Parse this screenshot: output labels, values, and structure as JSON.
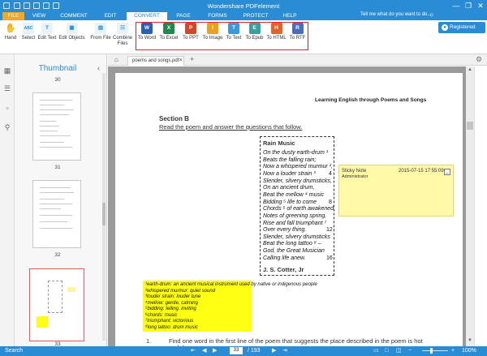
{
  "window": {
    "title": "Wondershare PDFelement",
    "controls": [
      "—",
      "❐",
      "✕"
    ]
  },
  "menu": {
    "tabs": [
      "FILE",
      "VIEW",
      "COMMENT",
      "EDIT",
      "CONVERT",
      "PAGE",
      "FORMS",
      "PROTECT",
      "HELP"
    ],
    "active": "CONVERT",
    "tell_me": "Tell me what do you want to do..."
  },
  "ribbon": {
    "tools": [
      {
        "label": "Hand",
        "icon": "hand-icon"
      },
      {
        "label": "Select",
        "icon": "select-icon"
      },
      {
        "label": "Edit Text",
        "icon": "edit-text-icon"
      },
      {
        "label": "Edit Objects",
        "icon": "edit-objects-icon"
      },
      {
        "label": "From File",
        "icon": "folder-icon"
      },
      {
        "label": "Combine Files",
        "icon": "combine-icon"
      }
    ],
    "convert": [
      {
        "label": "To Word",
        "letter": "W",
        "color": "#2b5fb4"
      },
      {
        "label": "To Excel",
        "letter": "X",
        "color": "#1f8a4c"
      },
      {
        "label": "To PPT",
        "letter": "P",
        "color": "#d24726"
      },
      {
        "label": "To Image",
        "letter": "I",
        "color": "#e8a21f"
      },
      {
        "label": "To Text",
        "letter": "T",
        "color": "#3a9ad9"
      },
      {
        "label": "To Epub",
        "letter": "E",
        "color": "#3aa0a0"
      },
      {
        "label": "To HTML",
        "letter": "H",
        "color": "#e2632b"
      },
      {
        "label": "To RTF",
        "letter": "R",
        "color": "#4a6fb8"
      }
    ],
    "registered": "Registered"
  },
  "thumbnails": {
    "title": "Thumbnail",
    "pages": [
      "30",
      "31",
      "32",
      "33"
    ]
  },
  "tab": {
    "doc_name": "poems and songs.pdf"
  },
  "document": {
    "header": "Learning English through Poems and Songs",
    "section": "Section B",
    "instruction": "Read the poem and answer the questions that follow.",
    "poem": {
      "title": "Rain Music",
      "lines": [
        {
          "text": "On the dusty earth-drum ¹",
          "no": ""
        },
        {
          "text": "  Beats the falling rain;",
          "no": ""
        },
        {
          "text": "Now a whispered murmur ²,",
          "no": ""
        },
        {
          "text": "   Now a louder strain ³",
          "no": "4"
        },
        {
          "text": "Slender, silvery drumsticks,",
          "no": ""
        },
        {
          "text": "  On an ancient drum,",
          "no": ""
        },
        {
          "text": "Beat the mellow ⁴ music",
          "no": ""
        },
        {
          "text": "   Bidding ⁵ life to come",
          "no": "8"
        },
        {
          "text": "Chords ⁶ of earth awakened,",
          "no": ""
        },
        {
          "text": "  Notes of greening spring,",
          "no": ""
        },
        {
          "text": "Rise and fall triumphant ⁷",
          "no": ""
        },
        {
          "text": "  Over every thing.",
          "no": "12"
        },
        {
          "text": "Slender, silvery drumsticks",
          "no": ""
        },
        {
          "text": "Beat the long tattoo ⁸ –",
          "no": ""
        },
        {
          "text": "God, the Great Musician",
          "no": ""
        },
        {
          "text": "Calling life anew.",
          "no": "16"
        }
      ],
      "author": "J. S. Cotter, Jr"
    },
    "footnotes": [
      "¹earth-drum: an ancient musical instrument used by native or indigenous people",
      "²whispered murmur: quiet sound",
      "³louder strain: louder tune",
      "⁴mellow: gentle, calming",
      "⁵bidding: telling, inviting",
      "⁶chords: music",
      "⁷triumphant: victorious",
      "⁸long tattoo: drum music"
    ],
    "question": {
      "number": "1.",
      "text": "Find one word in the first line of the poem that suggests the place described in the poem is hot",
      "tail": "and dry."
    }
  },
  "sticky_note": {
    "title": "Sticky Note",
    "date": "2015-07-15 17:55:09",
    "author": "Administrator"
  },
  "statusbar": {
    "search": "Search",
    "page_current": "33",
    "page_total": "/ 193",
    "zoom": "100%"
  }
}
